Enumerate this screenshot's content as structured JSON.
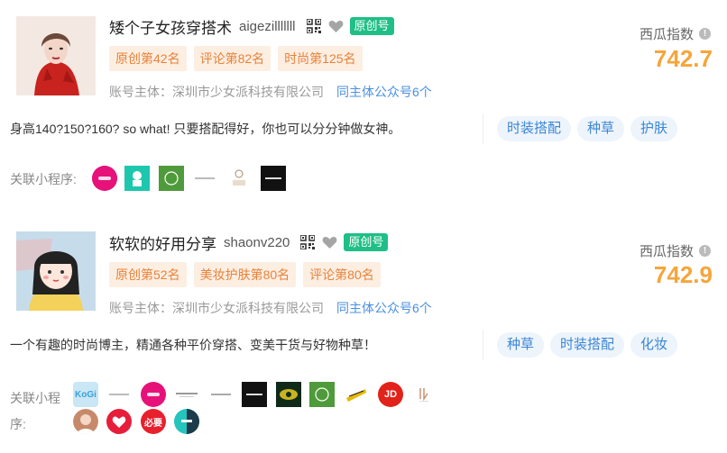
{
  "accounts": [
    {
      "name": "矮个子女孩穿搭术",
      "id": "aigezilllllll",
      "original_badge": "原创号",
      "ranks": [
        "原创第42名",
        "评论第82名",
        "时尚第125名"
      ],
      "entity_label": "账号主体：深圳市少女派科技有限公司",
      "entity_link": "同主体公众号6个",
      "score_label": "西瓜指数",
      "score_value": "742.7",
      "description": "身高140?150?160? so what! 只要搭配得好，你也可以分分钟做女神。",
      "tags": [
        "时装搭配",
        "种草",
        "护肤"
      ],
      "mini_programs_label": "关联小程序:",
      "mini_program_icons": [
        "miniapp-logo-pink",
        "miniapp-logo-teal",
        "miniapp-logo-green",
        "miniapp-logo-text",
        "miniapp-logo-young",
        "miniapp-logo-black"
      ]
    },
    {
      "name": "软软的好用分享",
      "id": "shaonv220",
      "original_badge": "原创号",
      "ranks": [
        "原创第52名",
        "美妆护肤第80名",
        "评论第80名"
      ],
      "entity_label": "账号主体：深圳市少女派科技有限公司",
      "entity_link": "同主体公众号6个",
      "score_label": "西瓜指数",
      "score_value": "742.9",
      "description": "一个有趣的时尚博主，精通各种平价穿搭、变美干货与好物种草！",
      "tags": [
        "种草",
        "时装搭配",
        "化妆"
      ],
      "mini_programs_label_line1": "关联小程",
      "mini_programs_label_line2": "序:",
      "mini_program_icons": [
        "miniapp-logo-kogi",
        "miniapp-logo-text",
        "miniapp-logo-pink",
        "miniapp-logo-text2",
        "miniapp-logo-acorn",
        "miniapp-logo-black",
        "miniapp-logo-dark-green",
        "miniapp-logo-green",
        "miniapp-logo-yellow",
        "miniapp-logo-jd",
        "miniapp-logo-lk",
        "miniapp-logo-avatar",
        "miniapp-logo-heart",
        "miniapp-logo-bibi",
        "miniapp-logo-circle"
      ]
    }
  ],
  "colors": {
    "badge_green": "#1fbf87",
    "rank_bg": "#fdeee2",
    "rank_text": "#e8833a",
    "score": "#f6a53a",
    "tag_bg": "#edf4fb",
    "tag_text": "#3b86d6",
    "link": "#4a90e2"
  },
  "mini_program_texts": {
    "kogi": "KoGi",
    "jd": "JD",
    "bibi": "必要"
  }
}
